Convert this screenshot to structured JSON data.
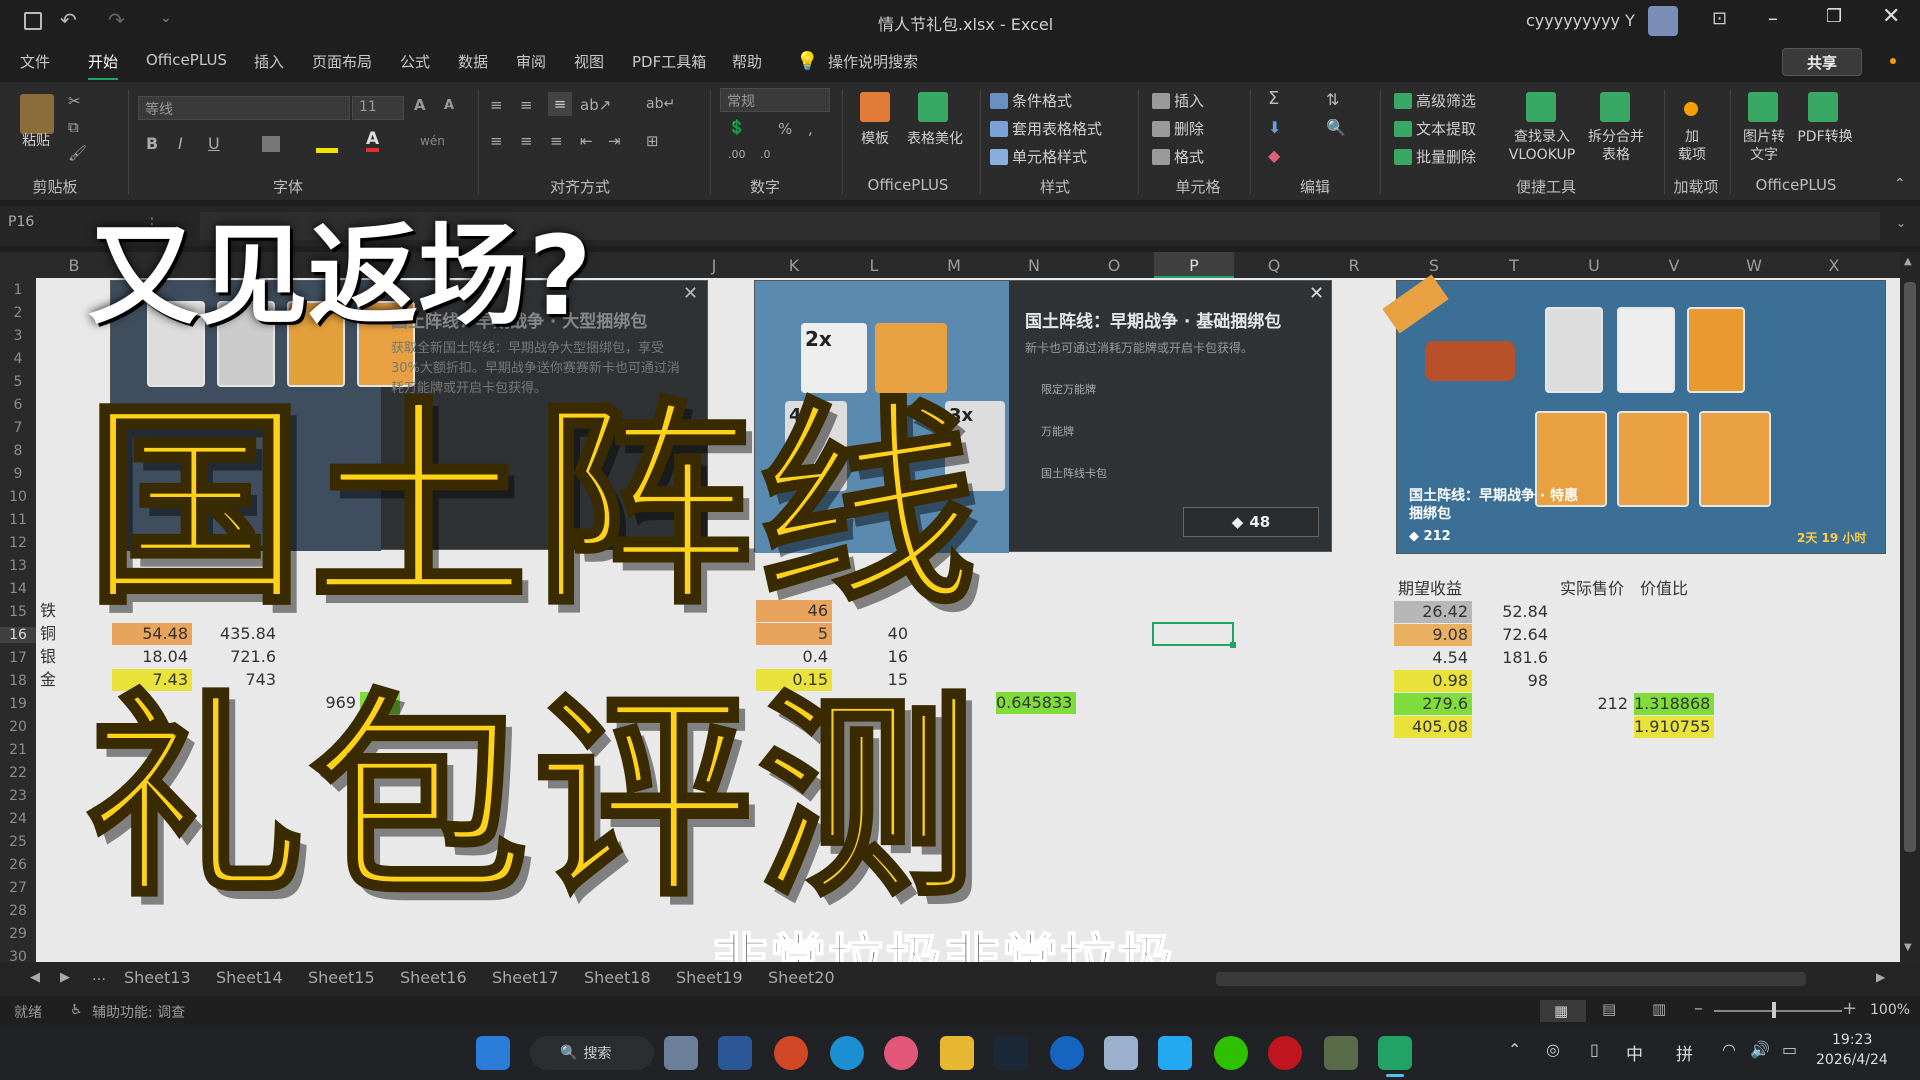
{
  "window": {
    "title": "情人节礼包.xlsx - Excel",
    "user": "cyyyyyyyyy Y"
  },
  "menu": {
    "tabs": [
      "文件",
      "开始",
      "OfficePLUS",
      "插入",
      "页面布局",
      "公式",
      "数据",
      "审阅",
      "视图",
      "PDF工具箱",
      "帮助"
    ],
    "search_placeholder": "操作说明搜索",
    "share": "共享"
  },
  "ribbon": {
    "font_name": "等线",
    "font_size": "11",
    "number_format": "常规",
    "groups": {
      "clipboard": "剪贴板",
      "font": "字体",
      "align": "对齐方式",
      "number": "数字",
      "officeplus": "OfficePLUS",
      "style": "样式",
      "cells": "单元格",
      "edit": "编辑",
      "tools": "便捷工具",
      "addins": "加载项",
      "officeplus2": "OfficePLUS"
    },
    "items": {
      "paste": "粘贴",
      "template": "模板",
      "beautify": "表格美化",
      "cond_format": "条件格式",
      "table_format": "套用表格格式",
      "cell_style": "单元格样式",
      "insert": "插入",
      "delete": "删除",
      "format": "格式",
      "adv_filter": "高级筛选",
      "text_extract": "文本提取",
      "batch_delete": "批量删除",
      "vlookup1": "查找录入",
      "vlookup2": "VLOOKUP",
      "split1": "拆分合并",
      "split2": "表格",
      "addin1": "加",
      "addin2": "载项",
      "img2text1": "图片转",
      "img2text2": "文字",
      "pdf1": "PDF转换"
    }
  },
  "namebox": "P16",
  "columns": [
    "B",
    "C",
    "D",
    "E",
    "F",
    "G",
    "H",
    "I",
    "J",
    "K",
    "L",
    "M",
    "N",
    "O",
    "P",
    "Q",
    "R",
    "S",
    "T",
    "U",
    "V",
    "W",
    "X"
  ],
  "rows": [
    "1",
    "2",
    "3",
    "4",
    "5",
    "6",
    "7",
    "8",
    "9",
    "10",
    "11",
    "12",
    "13",
    "14",
    "15",
    "16",
    "17",
    "18",
    "19",
    "20",
    "21",
    "22",
    "23",
    "24",
    "25",
    "26",
    "27",
    "28",
    "29",
    "30"
  ],
  "left_table": {
    "labels": [
      "铁",
      "铜",
      "银",
      "金"
    ],
    "col1": [
      "54.48",
      "18.04",
      "7.43"
    ],
    "col2": [
      "435.84",
      "721.6",
      "743"
    ],
    "k": [
      "46",
      "5",
      "0.4",
      "0.15"
    ],
    "l": [
      "40",
      "16",
      "15"
    ],
    "extra": [
      "969",
      "48",
      "0.645833"
    ]
  },
  "right_table": {
    "headers": [
      "期望收益",
      "实际售价",
      "价值比"
    ],
    "expected": [
      "26.42",
      "9.08",
      "4.54",
      "0.98",
      "279.6",
      "405.08"
    ],
    "price": [
      "52.84",
      "72.64",
      "181.6",
      "98"
    ],
    "actual_price": "212",
    "ratio": [
      "1.318868",
      "1.910755"
    ]
  },
  "dialogs": {
    "d1_title": "国土阵线：早期战争 · 大型捆绑包",
    "d1_desc": "获取全新国土阵线：早期战争大型捆绑包，享受30%大额折扣。早期战争送你赛赛新卡也可通过消耗万能牌或开启卡包获得。",
    "d2_title": "国土阵线：早期战争 · 基础捆绑包",
    "d2_desc": "新卡也可通过消耗万能牌或开启卡包获得。",
    "d2_items": [
      "限定万能牌",
      "万能牌",
      "国土阵线卡包"
    ],
    "d2_price": "48",
    "d3_title": "国土阵线：早期战争 · 特惠捆绑包",
    "d3_price": "212",
    "d3_timer": "2天 19 小时",
    "card_mult": [
      "2x",
      "3x",
      "4x",
      "5"
    ]
  },
  "overlay": {
    "top": "又见返场?",
    "line1": "国土阵线",
    "line2": "礼包评测",
    "subtitle": "非常垃圾非常垃圾"
  },
  "sheets": [
    "Sheet13",
    "Sheet14",
    "Sheet15",
    "Sheet16",
    "Sheet17",
    "Sheet18",
    "Sheet19",
    "Sheet20"
  ],
  "status": {
    "ready": "就绪",
    "accessibility": "辅助功能: 调查",
    "zoom": "100%"
  },
  "taskbar": {
    "search": "搜索",
    "ime1": "中",
    "ime2": "拼",
    "time": "19:23",
    "date": "2026/4/24"
  },
  "colors": {
    "accent_yellow": "#ffd21a",
    "excel_green": "#21a366",
    "cell_yellow": "#e8e23a",
    "cell_green": "#7fdc3a"
  }
}
